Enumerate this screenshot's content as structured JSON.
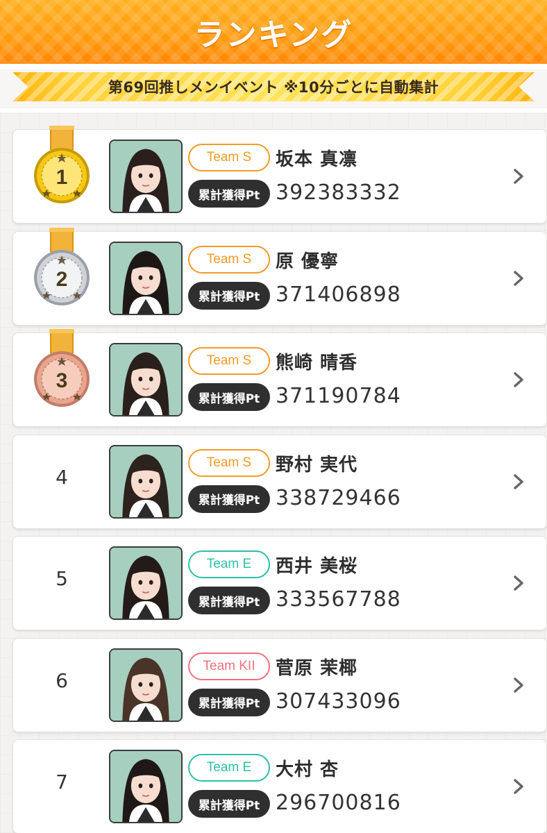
{
  "header": {
    "title": "ランキング"
  },
  "event_banner": {
    "text": "第69回推しメンイベント ※10分ごとに自動集計"
  },
  "pt_label": "累計獲得Pt",
  "team_colors": {
    "Team S": "#f39a26",
    "Team E": "#2cc0a8",
    "Team KII": "#f0707f"
  },
  "medal_colors": {
    "1": "#f4c815",
    "2": "#cfd3d8",
    "3": "#e9a58f"
  },
  "rankings": [
    {
      "rank": "1",
      "team": "Team S",
      "name": "坂本 真凛",
      "points": "392383332"
    },
    {
      "rank": "2",
      "team": "Team S",
      "name": "原 優寧",
      "points": "371406898"
    },
    {
      "rank": "3",
      "team": "Team S",
      "name": "熊崎 晴香",
      "points": "371190784"
    },
    {
      "rank": "4",
      "team": "Team S",
      "name": "野村 実代",
      "points": "338729466"
    },
    {
      "rank": "5",
      "team": "Team E",
      "name": "西井 美桜",
      "points": "333567788"
    },
    {
      "rank": "6",
      "team": "Team KII",
      "name": "菅原 茉椰",
      "points": "307433096"
    },
    {
      "rank": "7",
      "team": "Team E",
      "name": "大村 杏",
      "points": "296700816"
    }
  ]
}
